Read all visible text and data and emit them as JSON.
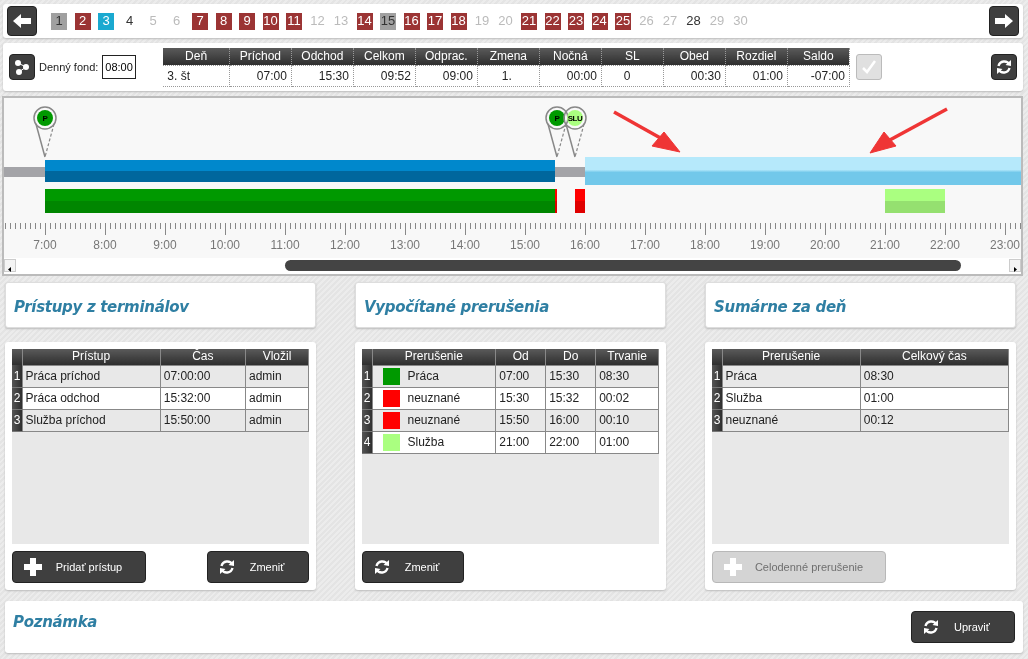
{
  "day_nav": {
    "days": [
      {
        "label": "1",
        "kind": "grey",
        "selected": false
      },
      {
        "label": "2",
        "kind": "red",
        "selected": false
      },
      {
        "label": "3",
        "kind": "plain",
        "selected": true
      },
      {
        "label": "4",
        "kind": "plain",
        "selected": false
      },
      {
        "label": "5",
        "kind": "faded",
        "selected": false
      },
      {
        "label": "6",
        "kind": "faded",
        "selected": false
      },
      {
        "label": "7",
        "kind": "red",
        "selected": false
      },
      {
        "label": "8",
        "kind": "red",
        "selected": false
      },
      {
        "label": "9",
        "kind": "red",
        "selected": false
      },
      {
        "label": "10",
        "kind": "red",
        "selected": false
      },
      {
        "label": "11",
        "kind": "red",
        "selected": false
      },
      {
        "label": "12",
        "kind": "faded",
        "selected": false
      },
      {
        "label": "13",
        "kind": "faded",
        "selected": false
      },
      {
        "label": "14",
        "kind": "red",
        "selected": false
      },
      {
        "label": "15",
        "kind": "grey",
        "selected": false
      },
      {
        "label": "16",
        "kind": "red",
        "selected": false
      },
      {
        "label": "17",
        "kind": "red",
        "selected": false
      },
      {
        "label": "18",
        "kind": "red",
        "selected": false
      },
      {
        "label": "19",
        "kind": "faded",
        "selected": false
      },
      {
        "label": "20",
        "kind": "faded",
        "selected": false
      },
      {
        "label": "21",
        "kind": "red",
        "selected": false
      },
      {
        "label": "22",
        "kind": "red",
        "selected": false
      },
      {
        "label": "23",
        "kind": "red",
        "selected": false
      },
      {
        "label": "24",
        "kind": "red",
        "selected": false
      },
      {
        "label": "25",
        "kind": "red",
        "selected": false
      },
      {
        "label": "26",
        "kind": "faded",
        "selected": false
      },
      {
        "label": "27",
        "kind": "faded",
        "selected": false
      },
      {
        "label": "28",
        "kind": "plain",
        "selected": false
      },
      {
        "label": "29",
        "kind": "faded",
        "selected": false
      },
      {
        "label": "30",
        "kind": "faded",
        "selected": false
      }
    ]
  },
  "summary": {
    "fund_label": "Denný fond:",
    "fund_value": "08:00",
    "columns": [
      "Deň",
      "Príchod",
      "Odchod",
      "Celkom",
      "Odprac.",
      "Zmena",
      "Nočná",
      "SL",
      "Obed",
      "Rozdiel",
      "Saldo"
    ],
    "row": [
      "3. št",
      "07:00",
      "15:30",
      "09:52",
      "09:00",
      "1.",
      "00:00",
      "0",
      "00:30",
      "01:00",
      "-07:00"
    ],
    "confirm_disabled": true
  },
  "timeline": {
    "hours": [
      "7:00",
      "8:00",
      "9:00",
      "10:00",
      "11:00",
      "12:00",
      "13:00",
      "14:00",
      "15:00",
      "16:00",
      "17:00",
      "18:00",
      "19:00",
      "20:00",
      "21:00",
      "22:00",
      "23:00"
    ],
    "markers": [
      {
        "label": "P",
        "color": "#009900"
      },
      {
        "label": "P",
        "color": "#009900"
      },
      {
        "label": "SLU",
        "color": "#aaff80"
      }
    ]
  },
  "panels": [
    {
      "title": "Prístupy z terminálov",
      "columns": [
        "Prístup",
        "Čas",
        "Vložil"
      ],
      "rows": [
        {
          "number": "1",
          "cells": [
            "Práca príchod",
            "07:00:00",
            "admin"
          ]
        },
        {
          "number": "2",
          "cells": [
            "Práca odchod",
            "15:32:00",
            "admin"
          ]
        },
        {
          "number": "3",
          "cells": [
            "Služba príchod",
            "15:50:00",
            "admin"
          ]
        }
      ],
      "buttons": [
        {
          "label": "Pridať prístup",
          "kind": "add",
          "disabled": false
        },
        {
          "label": "Zmeniť",
          "kind": "refresh",
          "disabled": false
        }
      ]
    },
    {
      "title": "Vypočítané prerušenia",
      "columns": [
        "Prerušenie",
        "Od",
        "Do",
        "Trvanie"
      ],
      "rows": [
        {
          "number": "1",
          "color": "#009900",
          "cells": [
            "Práca",
            "07:00",
            "15:30",
            "08:30"
          ]
        },
        {
          "number": "2",
          "color": "#ff0000",
          "cells": [
            "neuznané",
            "15:30",
            "15:32",
            "00:02"
          ]
        },
        {
          "number": "3",
          "color": "#ff0000",
          "cells": [
            "neuznané",
            "15:50",
            "16:00",
            "00:10"
          ]
        },
        {
          "number": "4",
          "color": "#aaff80",
          "cells": [
            "Služba",
            "21:00",
            "22:00",
            "01:00"
          ]
        }
      ],
      "buttons": [
        {
          "label": "Zmeniť",
          "kind": "refresh",
          "disabled": false
        }
      ]
    },
    {
      "title": "Sumárne za deň",
      "columns": [
        "Prerušenie",
        "Celkový čas"
      ],
      "rows": [
        {
          "number": "1",
          "cells": [
            "Práca",
            "08:30"
          ]
        },
        {
          "number": "2",
          "cells": [
            "Služba",
            "01:00"
          ]
        },
        {
          "number": "3",
          "cells": [
            "neuznané",
            "00:12"
          ]
        }
      ],
      "buttons": [
        {
          "label": "Celodenné prerušenie",
          "kind": "add",
          "disabled": true
        }
      ]
    }
  ],
  "note": {
    "title": "Poznámka",
    "button": {
      "label": "Upraviť",
      "disabled": false
    }
  }
}
